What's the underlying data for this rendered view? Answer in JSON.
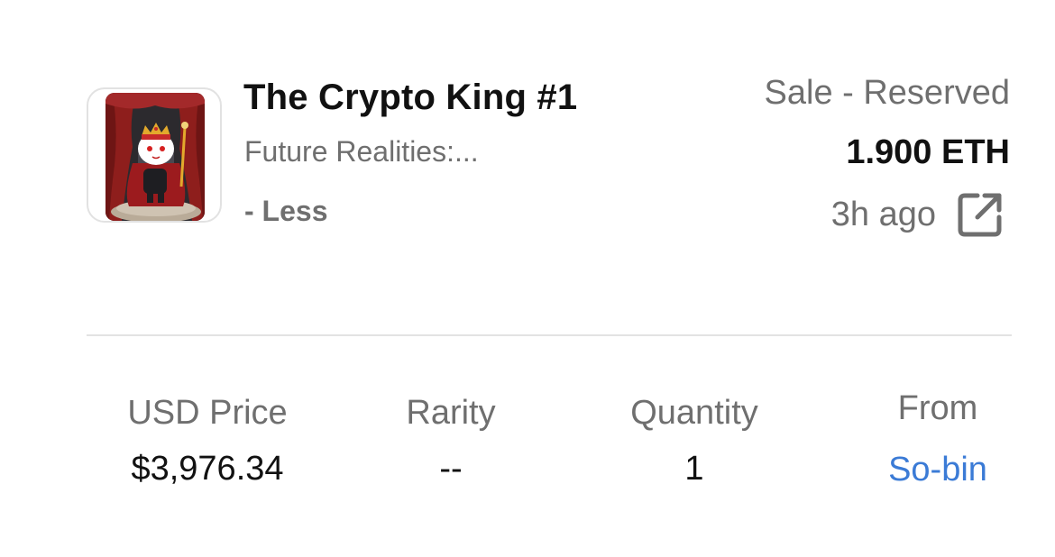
{
  "item": {
    "title": "The Crypto King #1",
    "collection": "Future Realities:...",
    "toggle_label": "- Less",
    "thumbnail_icon": "crypto-king-avatar-image"
  },
  "sale": {
    "type": "Sale - Reserved",
    "price": "1.900 ETH",
    "time_ago": "3h ago",
    "link_icon": "external-link-icon"
  },
  "stats": {
    "usd_price": {
      "label": "USD Price",
      "value": "$3,976.34"
    },
    "rarity": {
      "label": "Rarity",
      "value": "--"
    },
    "quantity": {
      "label": "Quantity",
      "value": "1"
    },
    "from": {
      "label": "From",
      "value": "So-bin"
    }
  },
  "colors": {
    "primary_text": "#111111",
    "secondary_text": "#6f6f6f",
    "link": "#3b7bd6",
    "divider": "#e3e3e3"
  }
}
